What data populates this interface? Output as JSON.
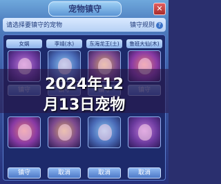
{
  "window": {
    "title": "宠物镇守",
    "close_label": "✕"
  },
  "hint": {
    "text": "请选择要镇守的宠物",
    "rules_label": "镇守规则",
    "rules_icon": "?"
  },
  "slots_top": [
    {
      "name": "女娲",
      "button": "镇守"
    },
    {
      "name": "李靖(水)",
      "button": "镇守"
    },
    {
      "name": "东海龙王(土)",
      "button": "镇守"
    },
    {
      "name": "鲁班大仙(木)",
      "button": "镇守"
    }
  ],
  "slots_bottom": [
    {
      "name": "",
      "button": "镇守"
    },
    {
      "name": "",
      "button": "取消"
    },
    {
      "name": "",
      "button": "取消"
    },
    {
      "name": "",
      "button": "取消"
    }
  ],
  "banner": {
    "line1": "2024年12",
    "line2": "月13日宠物"
  }
}
